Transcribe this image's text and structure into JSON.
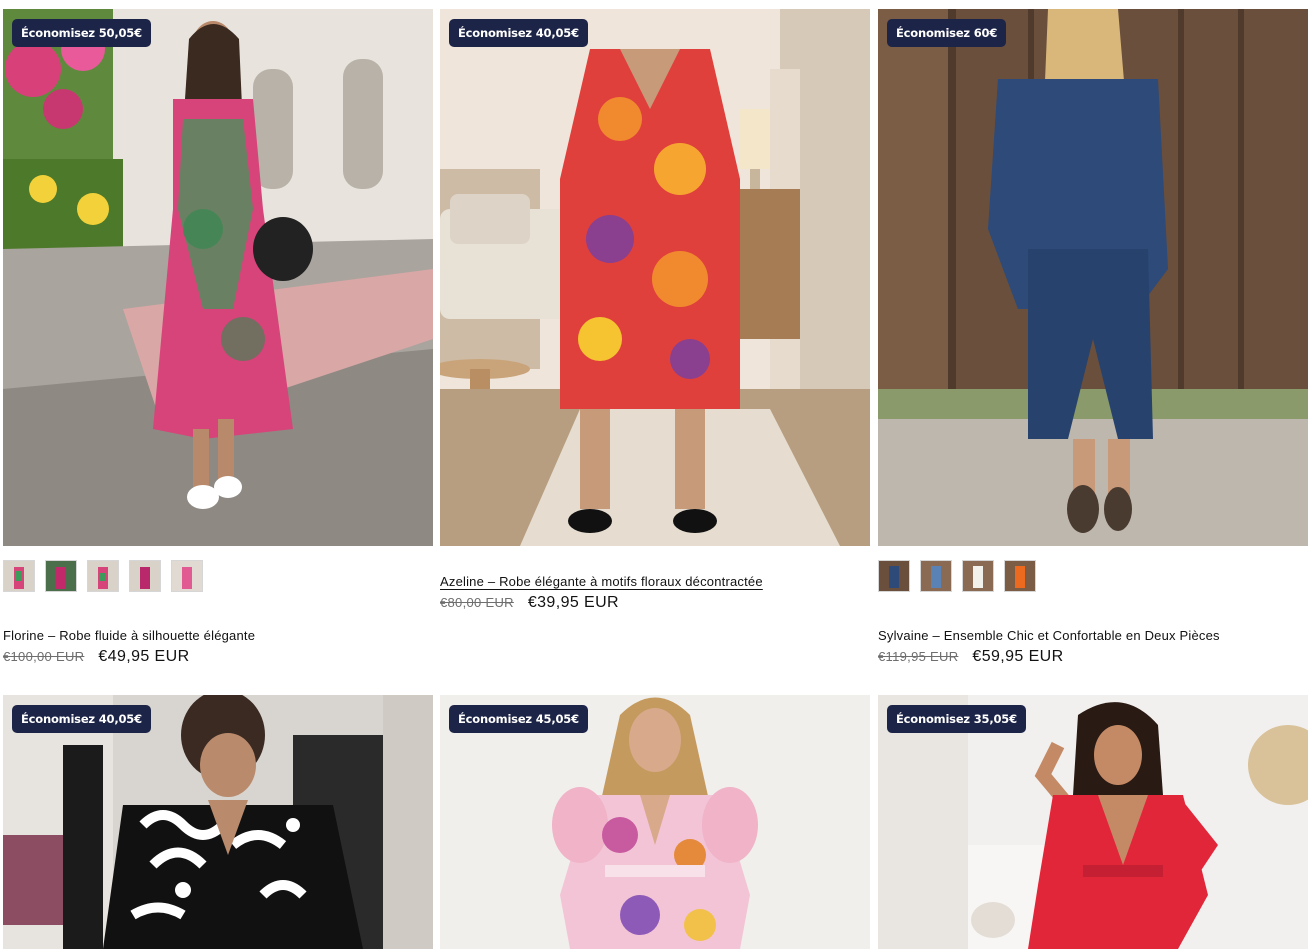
{
  "products": [
    {
      "badge": "Économisez 50,05€",
      "title": "Florine – Robe fluide à silhouette élégante",
      "old_price": "€100,00 EUR",
      "new_price": "€49,95 EUR",
      "swatches": [
        "pink-green",
        "magenta",
        "pink-green",
        "magenta",
        "pink"
      ]
    },
    {
      "badge": "Économisez 40,05€",
      "title": "Azeline – Robe élégante à motifs floraux décontractée",
      "old_price": "€80,00 EUR",
      "new_price": "€39,95 EUR",
      "swatches": []
    },
    {
      "badge": "Économisez 60€",
      "title": "Sylvaine – Ensemble Chic et Confortable en Deux Pièces",
      "old_price": "€119,95 EUR",
      "new_price": "€59,95 EUR",
      "swatches": [
        "navy",
        "denim-blue",
        "white",
        "orange"
      ]
    },
    {
      "badge": "Économisez 40,05€"
    },
    {
      "badge": "Économisez 45,05€"
    },
    {
      "badge": "Économisez 35,05€"
    }
  ],
  "colors": {
    "badge_bg": "#1c2447",
    "text": "#121212",
    "muted": "#6e6e6e"
  }
}
